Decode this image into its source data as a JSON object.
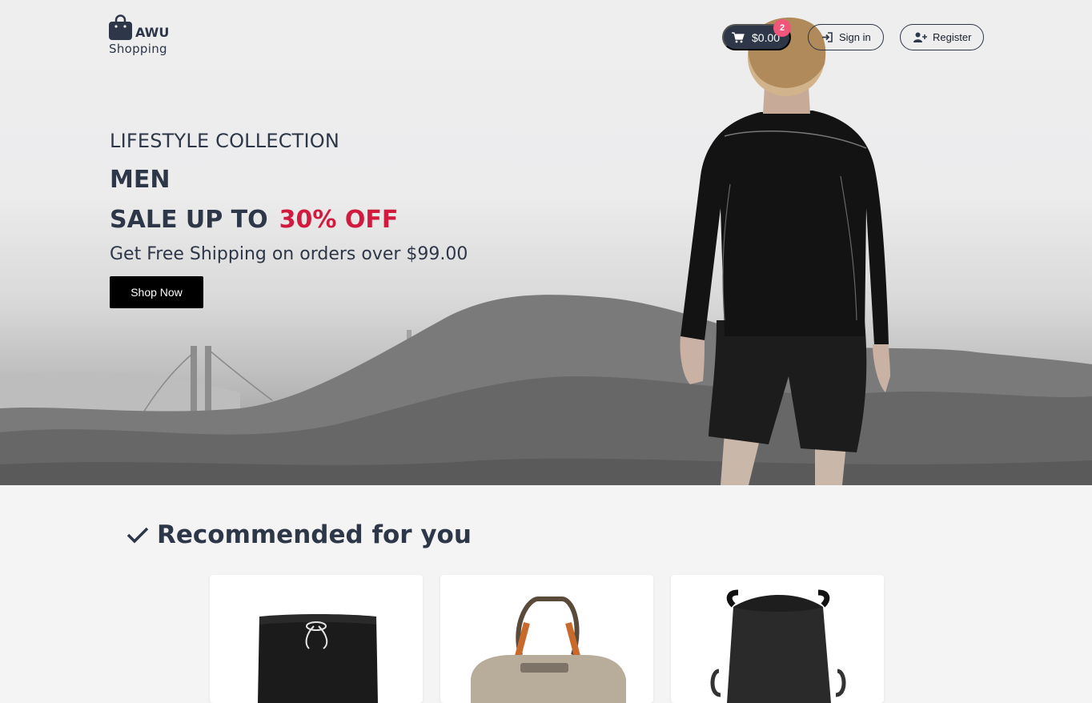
{
  "header": {
    "logo_name": "AWU",
    "logo_sub": "Shopping",
    "cart_total": "$0.00",
    "cart_count": "2",
    "signin_label": "Sign in",
    "register_label": "Register"
  },
  "hero": {
    "eyebrow": "LIFESTYLE COLLECTION",
    "headline_men": "MEN",
    "headline_sale": "SALE UP TO",
    "headline_off": "30% OFF",
    "shipping": "Get Free Shipping on orders over $99.00",
    "cta_label": "Shop Now"
  },
  "recommended": {
    "title": "Recommended for you",
    "products": [
      {
        "icon": "shorts-image"
      },
      {
        "icon": "duffel-bag-image"
      },
      {
        "icon": "drawstring-backpack-image"
      }
    ]
  },
  "colors": {
    "primary": "#2d3748",
    "accent": "#d11a3e",
    "badge": "#f0557a",
    "cta": "#000000"
  }
}
